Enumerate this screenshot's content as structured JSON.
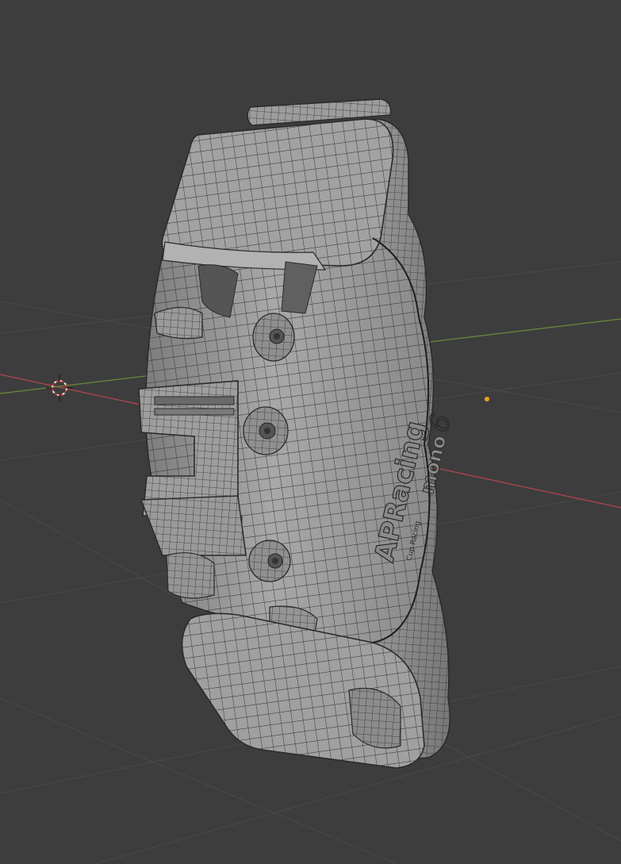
{
  "app": {
    "editor": "3D Viewport",
    "shading_mode": "wireframe-overlay"
  },
  "viewport": {
    "background_color": "#3d3d3d",
    "grid_color": "#4a4a4a",
    "x_axis_color": "#b0454f",
    "y_axis_color": "#6c8a3a",
    "cursor_icon": "3d-cursor-icon",
    "light_icon": "light-origin-icon",
    "light_color": "#f0a020"
  },
  "object": {
    "mesh_icon": "brake-caliper-mesh",
    "surface_color": "#9a9a9a",
    "wire_color": "#2a2a2a",
    "logo_text": "APRacing",
    "logo_subtext": "mono",
    "logo_number": "6",
    "small_text": "Cup Racing"
  }
}
